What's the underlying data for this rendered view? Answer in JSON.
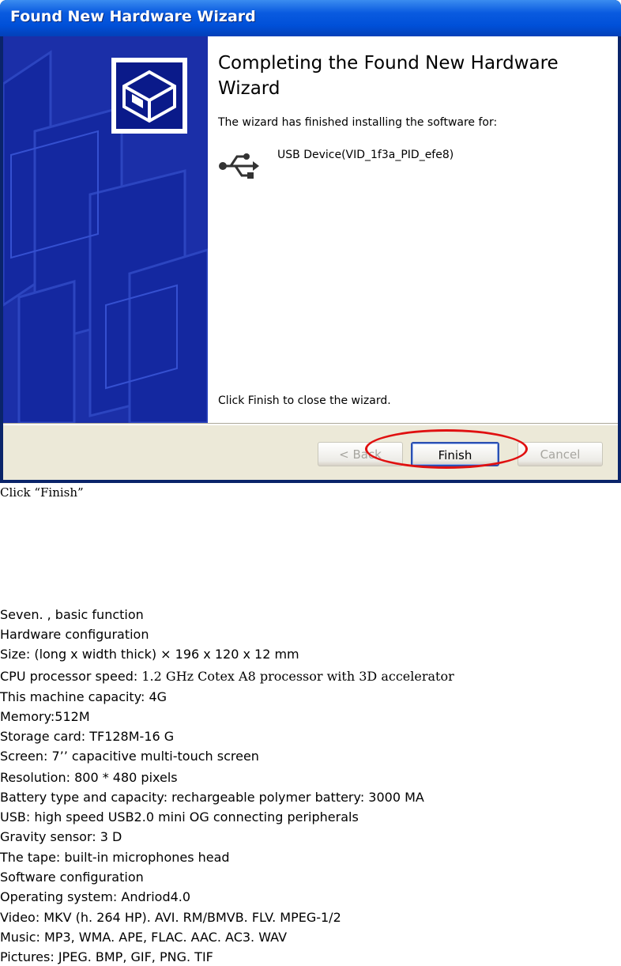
{
  "wizard": {
    "title": "Found New Hardware Wizard",
    "heading": "Completing the Found New Hardware Wizard",
    "message": "The wizard has finished installing the software for:",
    "device": "USB Device(VID_1f3a_PID_efe8)",
    "close_message": "Click Finish to close the wizard.",
    "buttons": {
      "back": "< Back",
      "finish": "Finish",
      "cancel": "Cancel"
    },
    "highlight_color": "#e01010"
  },
  "caption": "Click “Finish”",
  "spec": {
    "section": "Seven. , basic function",
    "hardware_heading": "Hardware configuration",
    "size": "Size: (long x width thick)  ×  196 x 120 x 12 mm",
    "cpu_label": "CPU processor speed: ",
    "cpu_value": "1.2 GHz Cotex A8 processor with 3D accelerator",
    "capacity": "This machine capacity: 4G",
    "memory": "Memory:512M",
    "storage": "Storage card: TF128M-16 G",
    "screen": "Screen: 7’’ capacitive multi-touch screen",
    "resolution": "Resolution: 800 * 480 pixels",
    "battery": "Battery type and capacity: rechargeable polymer battery: 3000 MA",
    "usb": "USB: high speed USB2.0 mini OG connecting peripherals",
    "gravity": "Gravity sensor: 3 D",
    "tape": "The tape: built-in microphones head",
    "software_heading": "Software configuration",
    "os": "Operating system: Andriod4.0",
    "video": "Video: MKV (h. 264 HP). AVI. RM/BMVB. FLV. MPEG-1/2",
    "music": "Music: MP3, WMA. APE, FLAC. AAC. AC3. WAV",
    "pictures": "Pictures: JPEG. BMP, GIF, PNG. TIF"
  }
}
